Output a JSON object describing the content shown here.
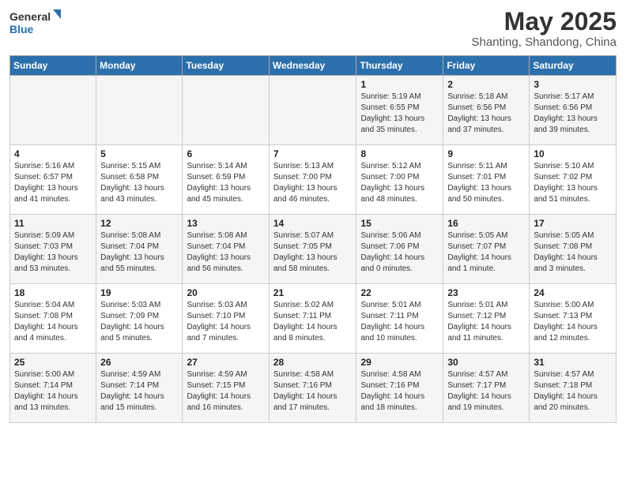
{
  "logo": {
    "line1": "General",
    "line2": "Blue"
  },
  "title": "May 2025",
  "subtitle": "Shanting, Shandong, China",
  "days_of_week": [
    "Sunday",
    "Monday",
    "Tuesday",
    "Wednesday",
    "Thursday",
    "Friday",
    "Saturday"
  ],
  "weeks": [
    [
      {
        "day": "",
        "info": ""
      },
      {
        "day": "",
        "info": ""
      },
      {
        "day": "",
        "info": ""
      },
      {
        "day": "",
        "info": ""
      },
      {
        "day": "1",
        "info": "Sunrise: 5:19 AM\nSunset: 6:55 PM\nDaylight: 13 hours\nand 35 minutes."
      },
      {
        "day": "2",
        "info": "Sunrise: 5:18 AM\nSunset: 6:56 PM\nDaylight: 13 hours\nand 37 minutes."
      },
      {
        "day": "3",
        "info": "Sunrise: 5:17 AM\nSunset: 6:56 PM\nDaylight: 13 hours\nand 39 minutes."
      }
    ],
    [
      {
        "day": "4",
        "info": "Sunrise: 5:16 AM\nSunset: 6:57 PM\nDaylight: 13 hours\nand 41 minutes."
      },
      {
        "day": "5",
        "info": "Sunrise: 5:15 AM\nSunset: 6:58 PM\nDaylight: 13 hours\nand 43 minutes."
      },
      {
        "day": "6",
        "info": "Sunrise: 5:14 AM\nSunset: 6:59 PM\nDaylight: 13 hours\nand 45 minutes."
      },
      {
        "day": "7",
        "info": "Sunrise: 5:13 AM\nSunset: 7:00 PM\nDaylight: 13 hours\nand 46 minutes."
      },
      {
        "day": "8",
        "info": "Sunrise: 5:12 AM\nSunset: 7:00 PM\nDaylight: 13 hours\nand 48 minutes."
      },
      {
        "day": "9",
        "info": "Sunrise: 5:11 AM\nSunset: 7:01 PM\nDaylight: 13 hours\nand 50 minutes."
      },
      {
        "day": "10",
        "info": "Sunrise: 5:10 AM\nSunset: 7:02 PM\nDaylight: 13 hours\nand 51 minutes."
      }
    ],
    [
      {
        "day": "11",
        "info": "Sunrise: 5:09 AM\nSunset: 7:03 PM\nDaylight: 13 hours\nand 53 minutes."
      },
      {
        "day": "12",
        "info": "Sunrise: 5:08 AM\nSunset: 7:04 PM\nDaylight: 13 hours\nand 55 minutes."
      },
      {
        "day": "13",
        "info": "Sunrise: 5:08 AM\nSunset: 7:04 PM\nDaylight: 13 hours\nand 56 minutes."
      },
      {
        "day": "14",
        "info": "Sunrise: 5:07 AM\nSunset: 7:05 PM\nDaylight: 13 hours\nand 58 minutes."
      },
      {
        "day": "15",
        "info": "Sunrise: 5:06 AM\nSunset: 7:06 PM\nDaylight: 14 hours\nand 0 minutes."
      },
      {
        "day": "16",
        "info": "Sunrise: 5:05 AM\nSunset: 7:07 PM\nDaylight: 14 hours\nand 1 minute."
      },
      {
        "day": "17",
        "info": "Sunrise: 5:05 AM\nSunset: 7:08 PM\nDaylight: 14 hours\nand 3 minutes."
      }
    ],
    [
      {
        "day": "18",
        "info": "Sunrise: 5:04 AM\nSunset: 7:08 PM\nDaylight: 14 hours\nand 4 minutes."
      },
      {
        "day": "19",
        "info": "Sunrise: 5:03 AM\nSunset: 7:09 PM\nDaylight: 14 hours\nand 5 minutes."
      },
      {
        "day": "20",
        "info": "Sunrise: 5:03 AM\nSunset: 7:10 PM\nDaylight: 14 hours\nand 7 minutes."
      },
      {
        "day": "21",
        "info": "Sunrise: 5:02 AM\nSunset: 7:11 PM\nDaylight: 14 hours\nand 8 minutes."
      },
      {
        "day": "22",
        "info": "Sunrise: 5:01 AM\nSunset: 7:11 PM\nDaylight: 14 hours\nand 10 minutes."
      },
      {
        "day": "23",
        "info": "Sunrise: 5:01 AM\nSunset: 7:12 PM\nDaylight: 14 hours\nand 11 minutes."
      },
      {
        "day": "24",
        "info": "Sunrise: 5:00 AM\nSunset: 7:13 PM\nDaylight: 14 hours\nand 12 minutes."
      }
    ],
    [
      {
        "day": "25",
        "info": "Sunrise: 5:00 AM\nSunset: 7:14 PM\nDaylight: 14 hours\nand 13 minutes."
      },
      {
        "day": "26",
        "info": "Sunrise: 4:59 AM\nSunset: 7:14 PM\nDaylight: 14 hours\nand 15 minutes."
      },
      {
        "day": "27",
        "info": "Sunrise: 4:59 AM\nSunset: 7:15 PM\nDaylight: 14 hours\nand 16 minutes."
      },
      {
        "day": "28",
        "info": "Sunrise: 4:58 AM\nSunset: 7:16 PM\nDaylight: 14 hours\nand 17 minutes."
      },
      {
        "day": "29",
        "info": "Sunrise: 4:58 AM\nSunset: 7:16 PM\nDaylight: 14 hours\nand 18 minutes."
      },
      {
        "day": "30",
        "info": "Sunrise: 4:57 AM\nSunset: 7:17 PM\nDaylight: 14 hours\nand 19 minutes."
      },
      {
        "day": "31",
        "info": "Sunrise: 4:57 AM\nSunset: 7:18 PM\nDaylight: 14 hours\nand 20 minutes."
      }
    ]
  ]
}
